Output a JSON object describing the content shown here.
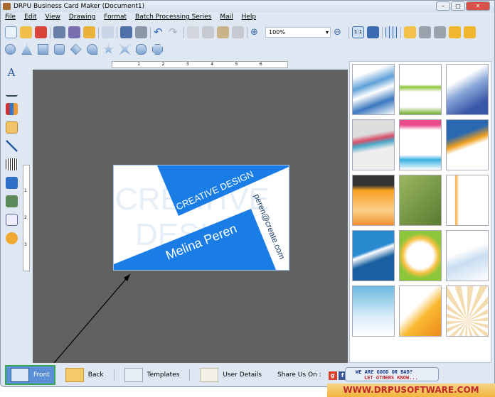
{
  "window": {
    "title": "DRPU Business Card Maker (Document1)"
  },
  "menu": [
    "File",
    "Edit",
    "View",
    "Drawing",
    "Format",
    "Batch Processing Series",
    "Mail",
    "Help"
  ],
  "toolbar": {
    "zoom_value": "100%",
    "icons": [
      "new",
      "open",
      "close",
      "save",
      "save-as",
      "export",
      "properties",
      "print",
      "database",
      "undo",
      "redo",
      "copy",
      "cut",
      "paste",
      "delete",
      "zoom-in",
      "zoom-out",
      "actual-size",
      "fit-window",
      "grid",
      "email",
      "bring-front",
      "send-back",
      "lock",
      "unlock"
    ]
  },
  "shapes": [
    "circle",
    "triangle",
    "rectangle",
    "rounded-rectangle",
    "diamond",
    "arc",
    "star",
    "cross-star",
    "burst",
    "octagon"
  ],
  "left_tools": [
    "text",
    "signature",
    "library",
    "image",
    "line",
    "barcode",
    "watermark",
    "picture",
    "document",
    "shapes"
  ],
  "ruler": {
    "h": [
      "1",
      "2",
      "3",
      "4",
      "5",
      "6"
    ],
    "v": [
      "1",
      "2",
      "3"
    ]
  },
  "card": {
    "watermark1": "CREATIVE",
    "watermark2": "DESIGN",
    "tagline": "CREATIVE DESIGN",
    "name": "Melina Peren",
    "email": "peren@create.com",
    "color": "#1a7de6"
  },
  "bottom": {
    "front": "Front",
    "back": "Back",
    "templates": "Templates",
    "user_details": "User Details",
    "share": "Share Us On :",
    "rate_line1": "WE ARE GOOD OR BAD?",
    "rate_line2": "LET OTHERS KNOW..."
  },
  "footer": {
    "url": "WWW.DRPUSOFTWARE.COM"
  }
}
